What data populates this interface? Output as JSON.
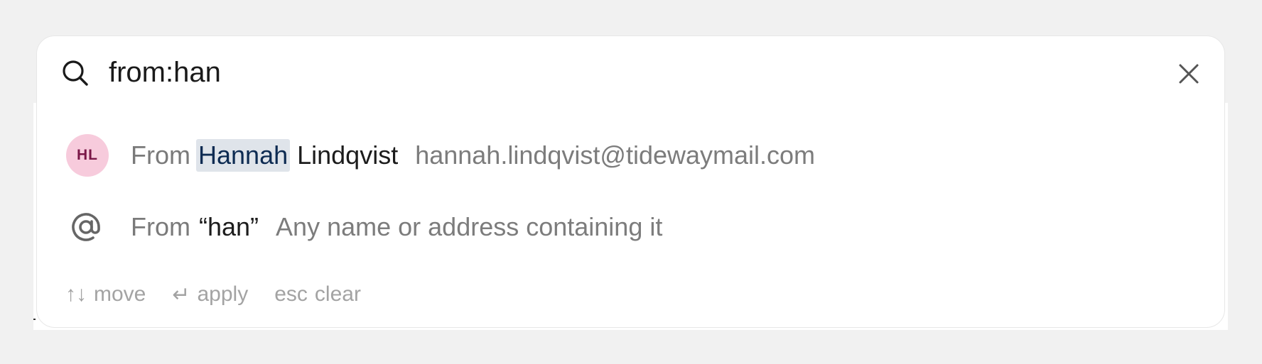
{
  "search": {
    "value": "from:han",
    "icon": "search-icon",
    "clear_icon": "close-icon"
  },
  "suggestions": [
    {
      "type": "contact",
      "avatar_initials": "HL",
      "avatar_bg": "#f7cbdc",
      "avatar_fg": "#7a1747",
      "prefix": "From",
      "match": "Hannah",
      "rest": "Lindqvist",
      "detail": "hannah.lindqvist@tidewaymail.com"
    },
    {
      "type": "text",
      "icon": "at-sign-icon",
      "prefix": "From",
      "query": "“han”",
      "detail": "Any name or address containing it"
    }
  ],
  "footer": {
    "move": {
      "keys": "↑↓",
      "label": "move"
    },
    "apply": {
      "keys": "↵",
      "label": "apply"
    },
    "clear": {
      "keys": "esc",
      "label": "clear"
    }
  },
  "colors": {
    "highlight_bg": "#dfe4ea",
    "highlight_fg": "#0d2b52",
    "muted_text": "#7a7a7a",
    "hint_text": "#a3a3a3"
  }
}
